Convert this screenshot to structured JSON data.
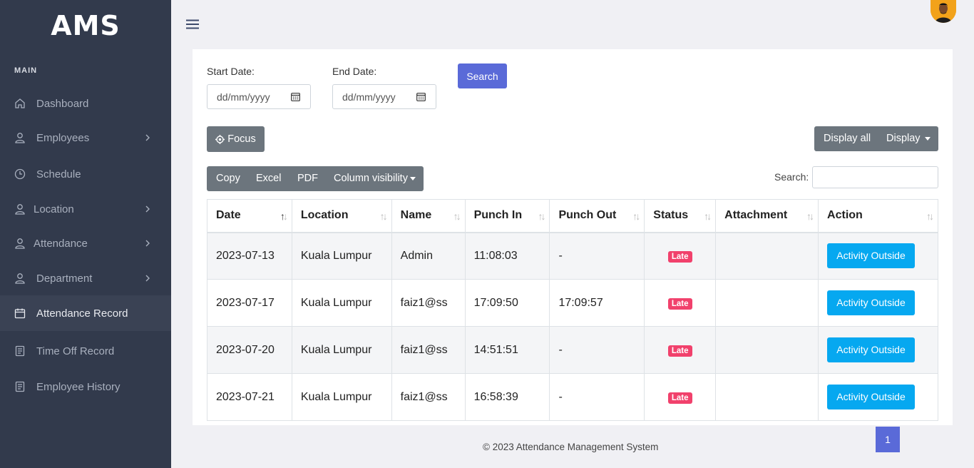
{
  "app": {
    "logo": "AMS"
  },
  "sidebar": {
    "section": "MAIN",
    "items": [
      {
        "label": "Dashboard",
        "icon": "home-icon",
        "has_submenu": false
      },
      {
        "label": "Employees",
        "icon": "user-icon",
        "has_submenu": true
      },
      {
        "label": "Schedule",
        "icon": "clock-icon",
        "has_submenu": false
      },
      {
        "label": "Location",
        "icon": "user-icon",
        "has_submenu": true
      },
      {
        "label": "Attendance",
        "icon": "user-icon",
        "has_submenu": true
      },
      {
        "label": "Department",
        "icon": "user-icon",
        "has_submenu": true
      },
      {
        "label": "Attendance Record",
        "icon": "calendar-icon",
        "has_submenu": false,
        "active": true
      },
      {
        "label": "Time Off Record",
        "icon": "document-icon",
        "has_submenu": false
      },
      {
        "label": "Employee History",
        "icon": "document-icon",
        "has_submenu": false
      }
    ]
  },
  "filters": {
    "start_label": "Start Date:",
    "start_placeholder": "dd/mm/yyyy",
    "end_label": "End Date:",
    "end_placeholder": "dd/mm/yyyy",
    "search_button": "Search"
  },
  "controls": {
    "focus": "Focus",
    "display_all": "Display all",
    "display": "Display"
  },
  "toolbar": {
    "copy": "Copy",
    "excel": "Excel",
    "pdf": "PDF",
    "column_visibility": "Column visibility"
  },
  "table_search": {
    "label": "Search:"
  },
  "table": {
    "columns": [
      "Date",
      "Location",
      "Name",
      "Punch In",
      "Punch Out",
      "Status",
      "Attachment",
      "Action"
    ],
    "rows": [
      {
        "date": "2023-07-13",
        "location": "Kuala Lumpur",
        "name": "Admin",
        "punch_in": "11:08:03",
        "punch_out": "-",
        "status": "Late",
        "attachment": "",
        "action": "Activity Outside"
      },
      {
        "date": "2023-07-17",
        "location": "Kuala Lumpur",
        "name": "faiz1@ss",
        "punch_in": "17:09:50",
        "punch_out": "17:09:57",
        "status": "Late",
        "attachment": "",
        "action": "Activity Outside"
      },
      {
        "date": "2023-07-20",
        "location": "Kuala Lumpur",
        "name": "faiz1@ss",
        "punch_in": "14:51:51",
        "punch_out": "-",
        "status": "Late",
        "attachment": "",
        "action": "Activity Outside"
      },
      {
        "date": "2023-07-21",
        "location": "Kuala Lumpur",
        "name": "faiz1@ss",
        "punch_in": "16:58:39",
        "punch_out": "-",
        "status": "Late",
        "attachment": "",
        "action": "Activity Outside"
      }
    ]
  },
  "pagination": {
    "current": "1"
  },
  "footer": {
    "text": "© 2023 Attendance Management System"
  },
  "colors": {
    "sidebar_bg": "#323a4c",
    "primary": "#5a6ad8",
    "secondary": "#6c757d",
    "info": "#06a8f0",
    "danger": "#f1416c"
  }
}
